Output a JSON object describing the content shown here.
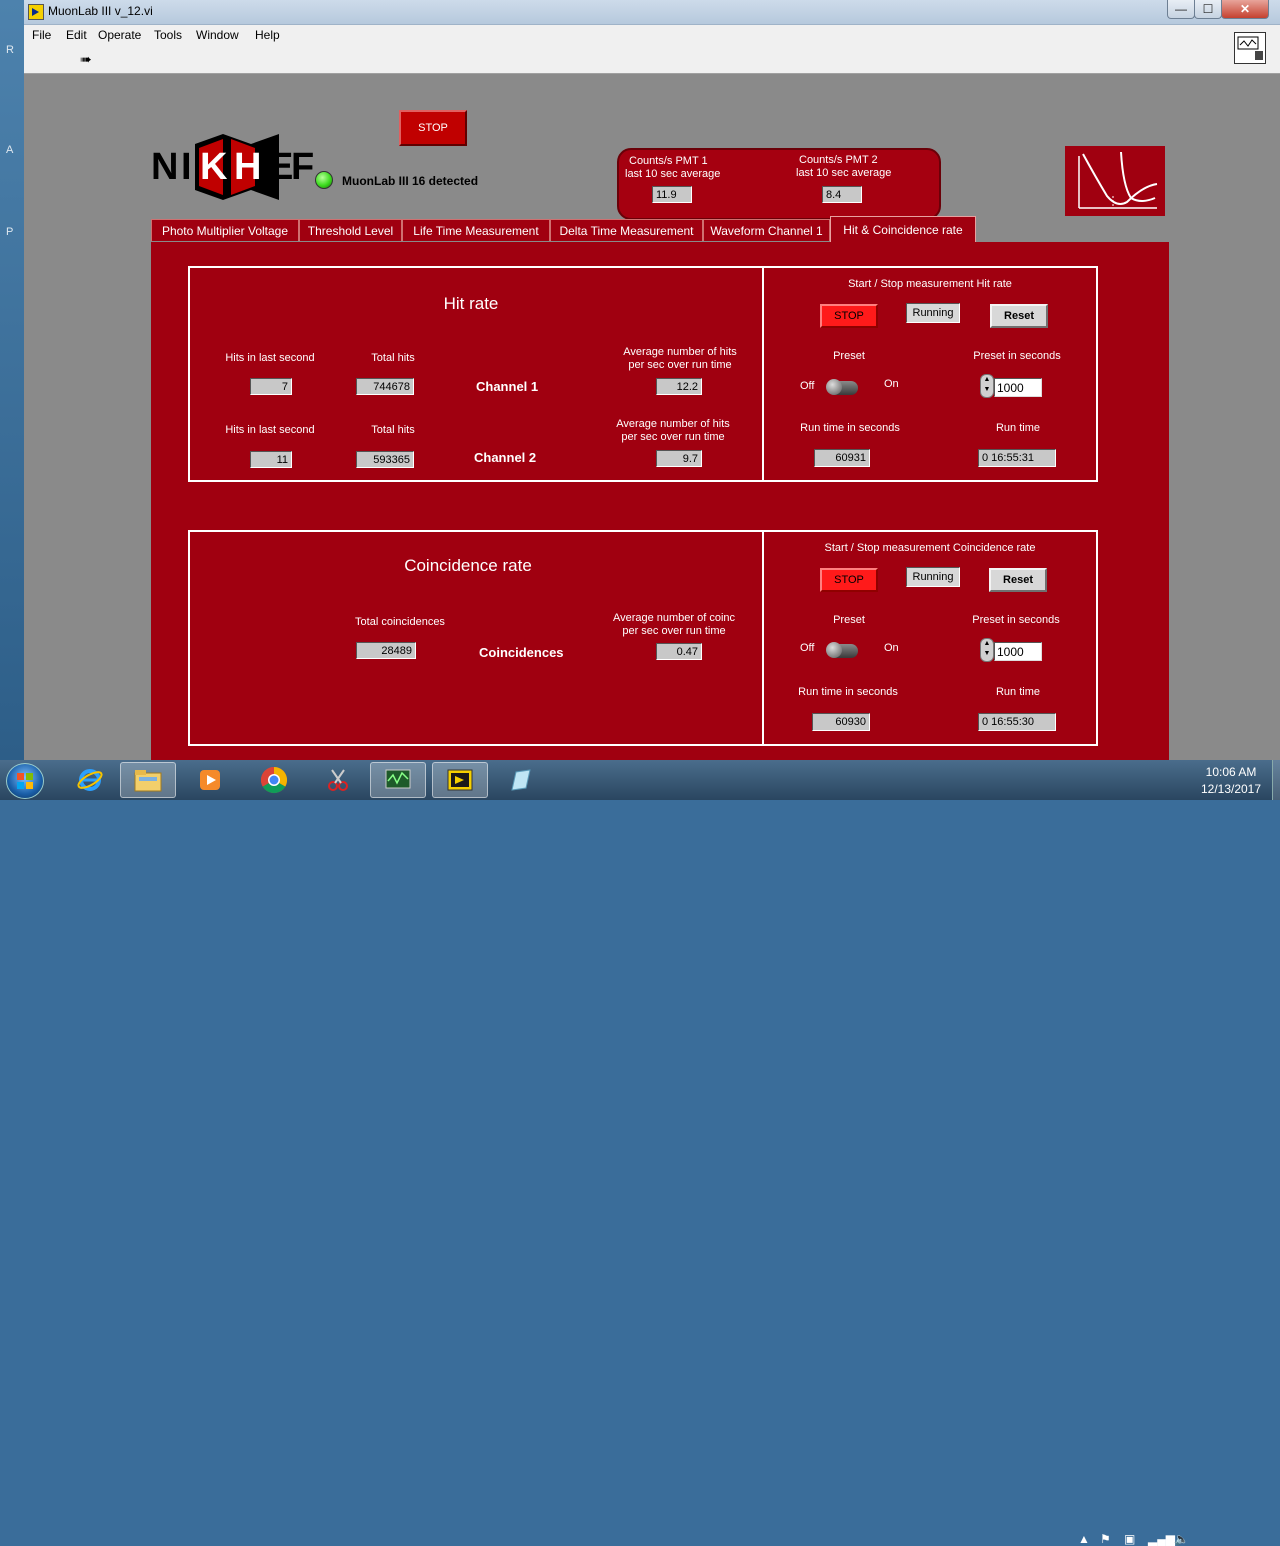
{
  "window": {
    "title": "MuonLab III v_12.vi",
    "min_glyph": "—",
    "max_glyph": "☐",
    "close_glyph": "✕"
  },
  "menu": [
    "File",
    "Edit",
    "Operate",
    "Tools",
    "Window",
    "Help"
  ],
  "header": {
    "stop_label": "STOP",
    "logo_letters": [
      "N",
      "I",
      "K",
      "H",
      "E",
      "F"
    ],
    "detected_text": "MuonLab III 16 detected",
    "pmt1": {
      "title": "Counts/s  PMT 1",
      "subtitle": "last 10 sec average",
      "value": "11.9"
    },
    "pmt2": {
      "title": "Counts/s  PMT 2",
      "subtitle": "last 10 sec average",
      "value": "8.4"
    }
  },
  "tabs": [
    {
      "label": "Photo Multiplier Voltage",
      "active": false
    },
    {
      "label": "Threshold Level",
      "active": false
    },
    {
      "label": "Life Time Measurement",
      "active": false
    },
    {
      "label": "Delta Time Measurement",
      "active": false
    },
    {
      "label": "Waveform Channel 1",
      "active": false
    },
    {
      "label": "Hit & Coincidence rate",
      "active": true
    }
  ],
  "hit_rate": {
    "title": "Hit rate",
    "hits_last_second_label": "Hits in last second",
    "total_hits_label": "Total hits",
    "avg_label_line1": "Average number of hits",
    "avg_label_line2": "per sec over run time",
    "channel1": {
      "name": "Channel 1",
      "hits_last_second": "7",
      "total_hits": "744678",
      "average": "12.2"
    },
    "channel2": {
      "name": "Channel 2",
      "hits_last_second": "11",
      "total_hits": "593365",
      "average": "9.7"
    },
    "control": {
      "title": "Start / Stop measurement Hit rate",
      "stop_label": "STOP",
      "status": "Running",
      "reset_label": "Reset",
      "preset_label": "Preset",
      "off_label": "Off",
      "on_label": "On",
      "preset_seconds_label": "Preset in seconds",
      "preset_seconds": "1000",
      "run_time_seconds_label": "Run time in seconds",
      "run_time_seconds": "60931",
      "run_time_label": "Run time",
      "run_time": "0  16:55:31"
    }
  },
  "coincidence": {
    "title": "Coincidence rate",
    "total_label": "Total coincidences",
    "total": "28489",
    "row_label": "Coincidences",
    "avg_label_line1": "Average number of coinc",
    "avg_label_line2": "per sec over run time",
    "average": "0.47",
    "control": {
      "title": "Start / Stop measurement Coincidence rate",
      "stop_label": "STOP",
      "status": "Running",
      "reset_label": "Reset",
      "preset_label": "Preset",
      "off_label": "Off",
      "on_label": "On",
      "preset_seconds_label": "Preset in seconds",
      "preset_seconds": "1000",
      "run_time_seconds_label": "Run time in seconds",
      "run_time_seconds": "60930",
      "run_time_label": "Run time",
      "run_time": "0  16:55:30"
    }
  },
  "taskbar": {
    "time": "10:06 AM",
    "date": "12/13/2017",
    "icons": [
      "ie-icon",
      "explorer-icon",
      "media-player-icon",
      "chrome-icon",
      "snipping-icon",
      "oscilloscope-icon",
      "labview-icon",
      "notepad-icon"
    ]
  },
  "colors": {
    "panel_bg": "#8a8a8a",
    "tab_red": "#a00010",
    "stop_red": "#ff1a1a",
    "led_green": "#3cdc1e"
  }
}
